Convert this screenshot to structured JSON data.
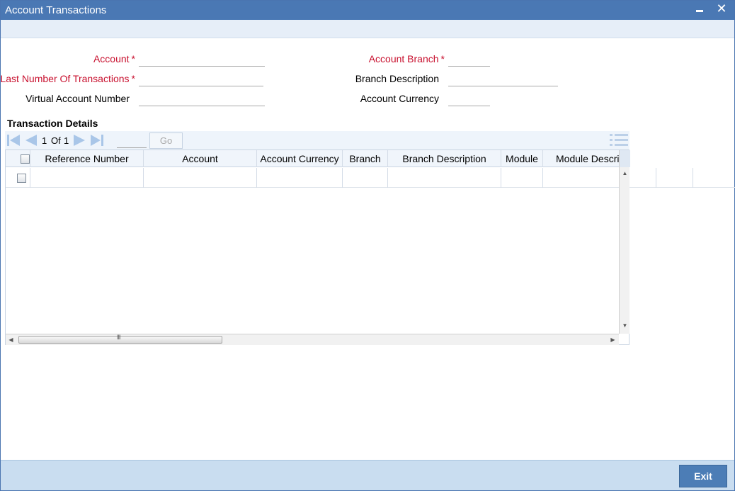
{
  "window": {
    "title": "Account Transactions"
  },
  "form": {
    "account": {
      "label": "Account",
      "required_mark": "*",
      "value": ""
    },
    "last_number": {
      "label": "Last Number Of Transactions",
      "required_mark": "*",
      "value": ""
    },
    "virtual_account": {
      "label": "Virtual Account Number",
      "value": ""
    },
    "account_branch": {
      "label": "Account Branch",
      "required_mark": "*",
      "value": ""
    },
    "branch_description": {
      "label": "Branch Description",
      "value": ""
    },
    "account_currency": {
      "label": "Account Currency",
      "value": ""
    }
  },
  "transactions": {
    "title": "Transaction Details",
    "pagination": {
      "current": "1",
      "of_label": "Of",
      "total": "1",
      "go_label": "Go"
    },
    "columns": [
      "Reference Number",
      "Account",
      "Account Currency",
      "Branch",
      "Branch Description",
      "Module",
      "Module Descrip"
    ],
    "h_scroll_grip": "III"
  },
  "footer": {
    "exit_label": "Exit"
  },
  "colors": {
    "titlebar": "#4a78b4",
    "required": "#c8102e",
    "footer": "#c9ddf0",
    "exit_button": "#4c7db6"
  },
  "icons": {
    "minimize": "minimize-icon",
    "close": "close-icon",
    "first": "first-page-icon",
    "prev": "prev-page-icon",
    "next": "next-page-icon",
    "last": "last-page-icon",
    "grid_menu": "list-menu-icon"
  }
}
